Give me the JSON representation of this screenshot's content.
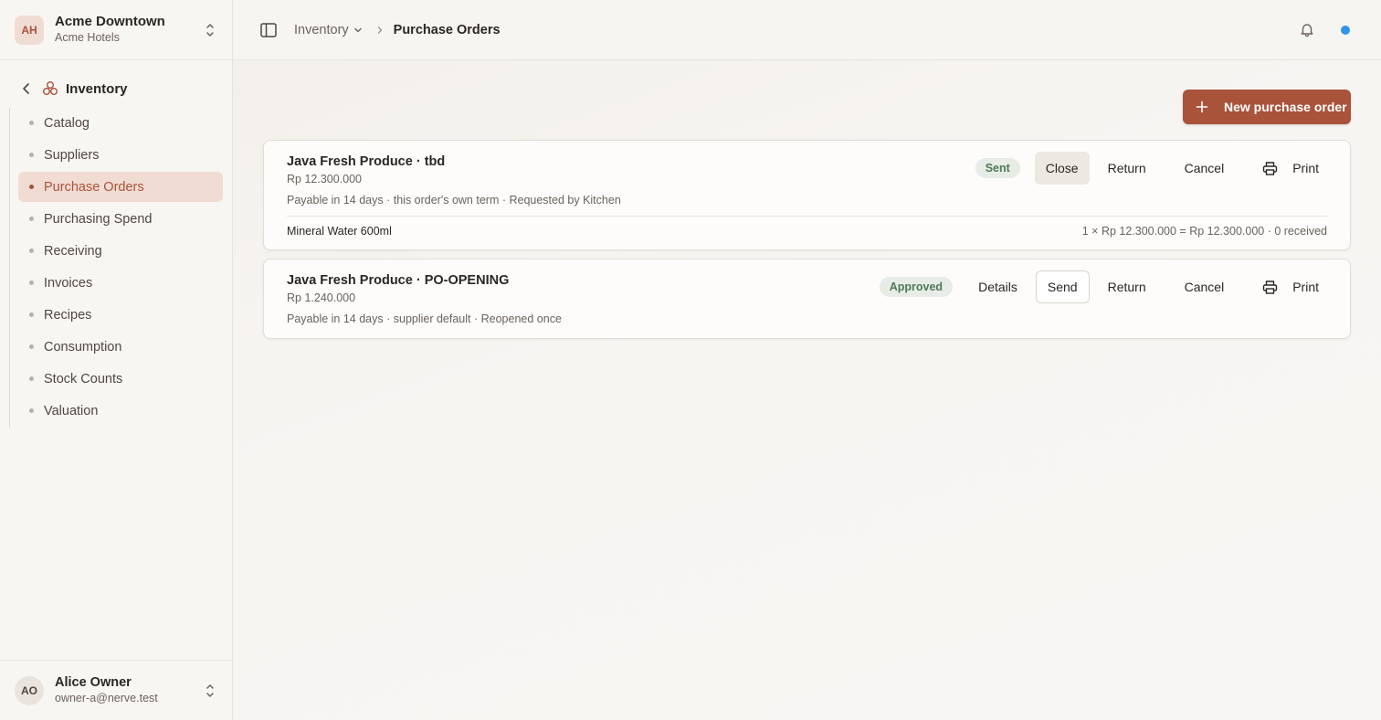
{
  "org": {
    "initials": "AH",
    "name": "Acme Downtown",
    "subtitle": "Acme Hotels"
  },
  "nav": {
    "section": "Inventory",
    "items": [
      {
        "label": "Catalog",
        "active": false
      },
      {
        "label": "Suppliers",
        "active": false
      },
      {
        "label": "Purchase Orders",
        "active": true
      },
      {
        "label": "Purchasing Spend",
        "active": false
      },
      {
        "label": "Receiving",
        "active": false
      },
      {
        "label": "Invoices",
        "active": false
      },
      {
        "label": "Recipes",
        "active": false
      },
      {
        "label": "Consumption",
        "active": false
      },
      {
        "label": "Stock Counts",
        "active": false
      },
      {
        "label": "Valuation",
        "active": false
      }
    ]
  },
  "user": {
    "initials": "AO",
    "name": "Alice Owner",
    "email": "owner-a@nerve.test"
  },
  "breadcrumb": {
    "parent": "Inventory",
    "current": "Purchase Orders"
  },
  "main": {
    "new_button": "New purchase order",
    "orders": [
      {
        "title": "Java Fresh Produce · tbd",
        "amount": "Rp 12.300.000",
        "meta": "Payable in 14 days · this order's own term · Requested by Kitchen",
        "status": "Sent",
        "actions": {
          "close": "Close",
          "return": "Return",
          "cancel": "Cancel",
          "print": "Print"
        },
        "lines": [
          {
            "name": "Mineral Water 600ml",
            "calc": "1 × Rp 12.300.000 = Rp 12.300.000 · 0 received"
          }
        ]
      },
      {
        "title": "Java Fresh Produce · PO-OPENING",
        "amount": "Rp 1.240.000",
        "meta": "Payable in 14 days · supplier default · Reopened once",
        "status": "Approved",
        "actions": {
          "details": "Details",
          "send": "Send",
          "return": "Return",
          "cancel": "Cancel",
          "print": "Print"
        }
      }
    ]
  },
  "colors": {
    "accent": "#a8533a",
    "accent_soft": "#f1dcd3",
    "status_green": "#4f7a59",
    "notify_dot": "#2f95e8"
  },
  "icons": [
    "updown-icon",
    "chevron-left-icon",
    "inventory-icon",
    "sidebar-toggle-icon",
    "chevron-down-icon",
    "chevron-right-icon",
    "bell-icon",
    "plus-icon",
    "printer-icon"
  ]
}
